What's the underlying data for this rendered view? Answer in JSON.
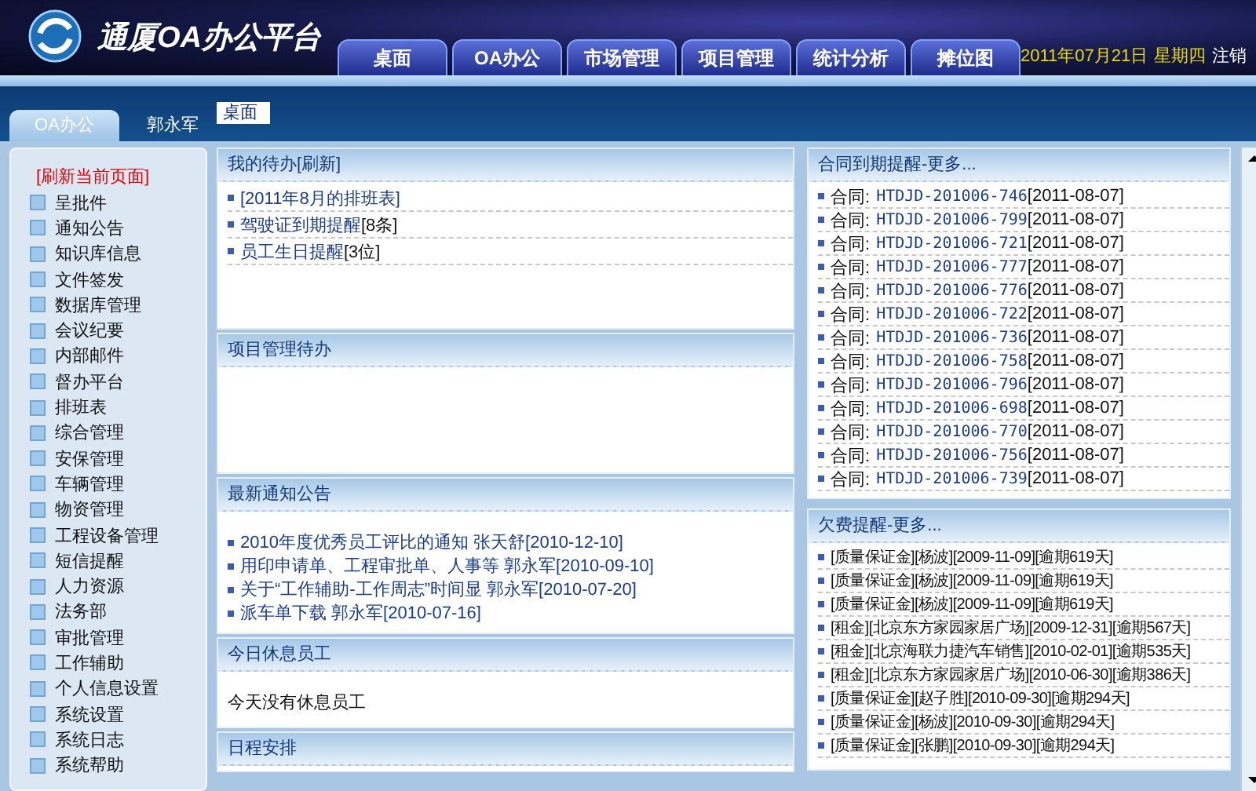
{
  "app": {
    "title": "通厦OA办公平台"
  },
  "nav_tabs": [
    {
      "label": "桌面"
    },
    {
      "label": "OA办公"
    },
    {
      "label": "市场管理"
    },
    {
      "label": "项目管理"
    },
    {
      "label": "统计分析"
    },
    {
      "label": "摊位图"
    }
  ],
  "header_info": {
    "date": "2011年07月21日",
    "weekday": "星期四",
    "logout": "注销"
  },
  "sub_tabs": [
    {
      "label": "OA办公",
      "selected": true
    },
    {
      "label": "郭永军",
      "selected": false
    }
  ],
  "breadcrumb": "桌面",
  "sidebar": {
    "refresh": "[刷新当前页面]",
    "items": [
      "呈批件",
      "通知公告",
      "知识库信息",
      "文件签发",
      "数据库管理",
      "会议纪要",
      "内部邮件",
      "督办平台",
      "排班表",
      "综合管理",
      "安保管理",
      "车辆管理",
      "物资管理",
      "工程设备管理",
      "短信提醒",
      "人力资源",
      "法务部",
      "审批管理",
      "工作辅助",
      "个人信息设置",
      "系统设置",
      "系统日志",
      "系统帮助"
    ]
  },
  "panels_middle": [
    {
      "title": "我的待办[刷新]",
      "kind": "todo",
      "items": [
        {
          "text": "[2011年8月的排班表]"
        },
        {
          "text": "驾驶证到期提醒",
          "count": " [8条]"
        },
        {
          "text": "员工生日提醒",
          "count": " [3位]"
        }
      ]
    },
    {
      "title": "项目管理待办",
      "kind": "empty"
    },
    {
      "title": "最新通知公告",
      "kind": "notice",
      "items": [
        "2010年度优秀员工评比的通知 张天舒[2010-12-10]",
        "用印申请单、工程审批单、人事等 郭永军[2010-09-10]",
        "关于“工作辅助-工作周志”时间显 郭永军[2010-07-20]",
        "派车单下载 郭永军[2010-07-16]"
      ]
    },
    {
      "title": "今日休息员工",
      "kind": "message",
      "text": "今天没有休息员工"
    },
    {
      "title": "日程安排",
      "kind": "empty"
    }
  ],
  "panels_right": [
    {
      "title": "合同到期提醒-更多...",
      "kind": "contract",
      "items": [
        {
          "label": "合同:",
          "code": "HTDJD-201006-746",
          "date": "[2011-08-07]"
        },
        {
          "label": "合同:",
          "code": "HTDJD-201006-799",
          "date": "[2011-08-07]"
        },
        {
          "label": "合同:",
          "code": "HTDJD-201006-721",
          "date": "[2011-08-07]"
        },
        {
          "label": "合同:",
          "code": "HTDJD-201006-777",
          "date": "[2011-08-07]"
        },
        {
          "label": "合同:",
          "code": "HTDJD-201006-776",
          "date": "[2011-08-07]"
        },
        {
          "label": "合同:",
          "code": "HTDJD-201006-722",
          "date": "[2011-08-07]"
        },
        {
          "label": "合同:",
          "code": "HTDJD-201006-736",
          "date": "[2011-08-07]"
        },
        {
          "label": "合同:",
          "code": "HTDJD-201006-758",
          "date": "[2011-08-07]"
        },
        {
          "label": "合同:",
          "code": "HTDJD-201006-796",
          "date": "[2011-08-07]"
        },
        {
          "label": "合同:",
          "code": "HTDJD-201006-698",
          "date": "[2011-08-07]"
        },
        {
          "label": "合同:",
          "code": "HTDJD-201006-770",
          "date": "[2011-08-07]"
        },
        {
          "label": "合同:",
          "code": "HTDJD-201006-756",
          "date": "[2011-08-07]"
        },
        {
          "label": "合同:",
          "code": "HTDJD-201006-739",
          "date": "[2011-08-07]"
        }
      ]
    },
    {
      "title": "欠费提醒-更多...",
      "kind": "arrears",
      "items": [
        "[质量保证金][杨波][2009-11-09][逾期619天]",
        "[质量保证金][杨波][2009-11-09][逾期619天]",
        "[质量保证金][杨波][2009-11-09][逾期619天]",
        "[租金][北京东方家园家居广场][2009-12-31][逾期567天]",
        "[租金][北京海联力捷汽车销售][2010-02-01][逾期535天]",
        "[租金][北京东方家园家居广场][2010-06-30][逾期386天]",
        "[质量保证金][赵子胜][2010-09-30][逾期294天]",
        "[质量保证金][杨波][2010-09-30][逾期294天]",
        "[质量保证金][张鹏][2010-09-30][逾期294天]"
      ]
    }
  ]
}
